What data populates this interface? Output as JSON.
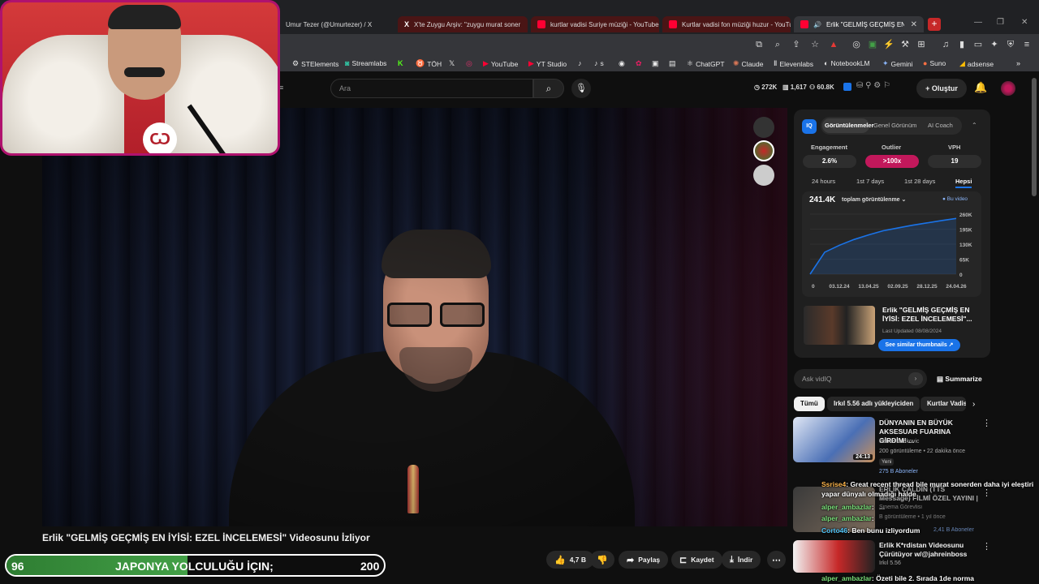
{
  "tabs": [
    {
      "label": "Umur Tezer (@Umurtezer) / X"
    },
    {
      "label": "X'te Zuygu Arşiv: \"zuygu murat soner"
    },
    {
      "label": "kurtlar vadisi Suriye müziği - YouTube"
    },
    {
      "label": "Kurtlar vadisi fon müziği huzur - YouTube"
    },
    {
      "label": "Erlik \"GELMİŞ GEÇMİŞ EN İYİ"
    }
  ],
  "bookmarks": [
    {
      "label": "STElements"
    },
    {
      "label": "Streamlabs"
    },
    {
      "label": "TÖH"
    },
    {
      "label": "YouTube"
    },
    {
      "label": "YT Studio"
    },
    {
      "label": "s"
    },
    {
      "label": "ChatGPT"
    },
    {
      "label": "Claude"
    },
    {
      "label": "Elevenlabs"
    },
    {
      "label": "NotebookLM"
    },
    {
      "label": "Gemini"
    },
    {
      "label": "Suno"
    },
    {
      "label": "adsense"
    }
  ],
  "header": {
    "search_placeholder": "Ara",
    "stats": [
      "272K",
      "1,617",
      "60.8K"
    ],
    "create_label": "Oluştur"
  },
  "video": {
    "title": "Erlik \"GELMİŞ GEÇMİŞ EN İYİSİ: EZEL İNCELEMESİ\" Videosunu İzliyor",
    "channel": "Irkıl 5.56",
    "likes": "4,7 B",
    "share_label": "Paylaş",
    "save_label": "Kaydet",
    "download_label": "İndir"
  },
  "goal": {
    "current": "96",
    "target": "200",
    "label": "JAPONYA YOLCULUĞU İÇIN;",
    "fraction": 0.48
  },
  "vidiq": {
    "tabs": [
      "Görüntülenmeler",
      "Genel Görünüm",
      "AI Coach"
    ],
    "metrics": [
      {
        "label": "Engagement",
        "value": "2.6%"
      },
      {
        "label": "Outlier",
        "value": ">100x"
      },
      {
        "label": "VPH",
        "value": "19"
      }
    ],
    "ranges": [
      "24 hours",
      "1st 7 days",
      "1st 28 days",
      "Hepsi"
    ],
    "total_views": "241.4K",
    "views_dropdown": "toplam görüntülenme",
    "legend": "Bu video",
    "video_title": "Erlik \"GELMİŞ GEÇMİŞ EN İYİSİ: EZEL İNCELEMESİ\"...",
    "updated": "Last Updated 08/08/2024",
    "similar_label": "See similar thumbnails",
    "ask_placeholder": "Ask vidIQ",
    "summarize_label": "Summarize"
  },
  "chart_data": {
    "type": "line",
    "x_ticks": [
      "0",
      "03.12.24",
      "13.04.25",
      "02.09.25",
      "28.12.25",
      "24.04.26"
    ],
    "y_ticks": [
      "0",
      "65K",
      "130K",
      "195K",
      "260K"
    ],
    "ylim": [
      0,
      260000
    ],
    "series": [
      {
        "name": "Bu video",
        "values": [
          0,
          95000,
          125000,
          150000,
          170000,
          188000,
          200000,
          212000,
          222000,
          232000,
          241400
        ]
      }
    ],
    "grid": true,
    "legend": "top-right"
  },
  "chips": [
    "Tümü",
    "Irkıl 5.56 adlı yükleyiciden",
    "Kurtlar Vadisi"
  ],
  "recommendations": [
    {
      "title": "DÜNYANIN EN BÜYÜK AKSESUAR FUARINA GİRDİM! ...",
      "channel": "Samet Jankovic",
      "meta": "200 görüntüleme • 22 dakika önce",
      "badge": "Yeni",
      "duration": "24:13",
      "sub": "275 B Aboneler"
    },
    {
      "title": "ERLİK ÇALDIN (TTS Message) FİLMİ ÖZEL YAYINI | ...",
      "channel": "Sinema Görevlisi",
      "meta": "B görüntüleme • 1 yıl önce",
      "badge": "",
      "duration": "",
      "sub": "2,41 B Aboneler"
    },
    {
      "title": "Erlik K*rdistan Videosunu Çürütüyor w/@jahreinboss",
      "channel": "Irkıl 5.56",
      "meta": "",
      "badge": "",
      "duration": "",
      "sub": ""
    }
  ],
  "chat": [
    {
      "name": "Ssrise4",
      "text": ": Great recent thread bile murat sonerden daha iyi eleştiri"
    },
    {
      "name": "",
      "text": "yapar dünyalı olmadığı halde"
    },
    {
      "name": "alper_ambazlar",
      "text": ":"
    },
    {
      "name": "alper_ambazlar",
      "text": ":"
    },
    {
      "name": "Corto46",
      "text": ": Ben bunu izliyordum"
    },
    {
      "name": "alper_ambazlar",
      "text": ": Özeti bile 2. Sırada 1de norma"
    }
  ],
  "colors": {
    "accent": "#1a73e8",
    "outlier": "#c2185b",
    "goal_fill": "#43a047",
    "overlay_border": "#b0126e"
  }
}
